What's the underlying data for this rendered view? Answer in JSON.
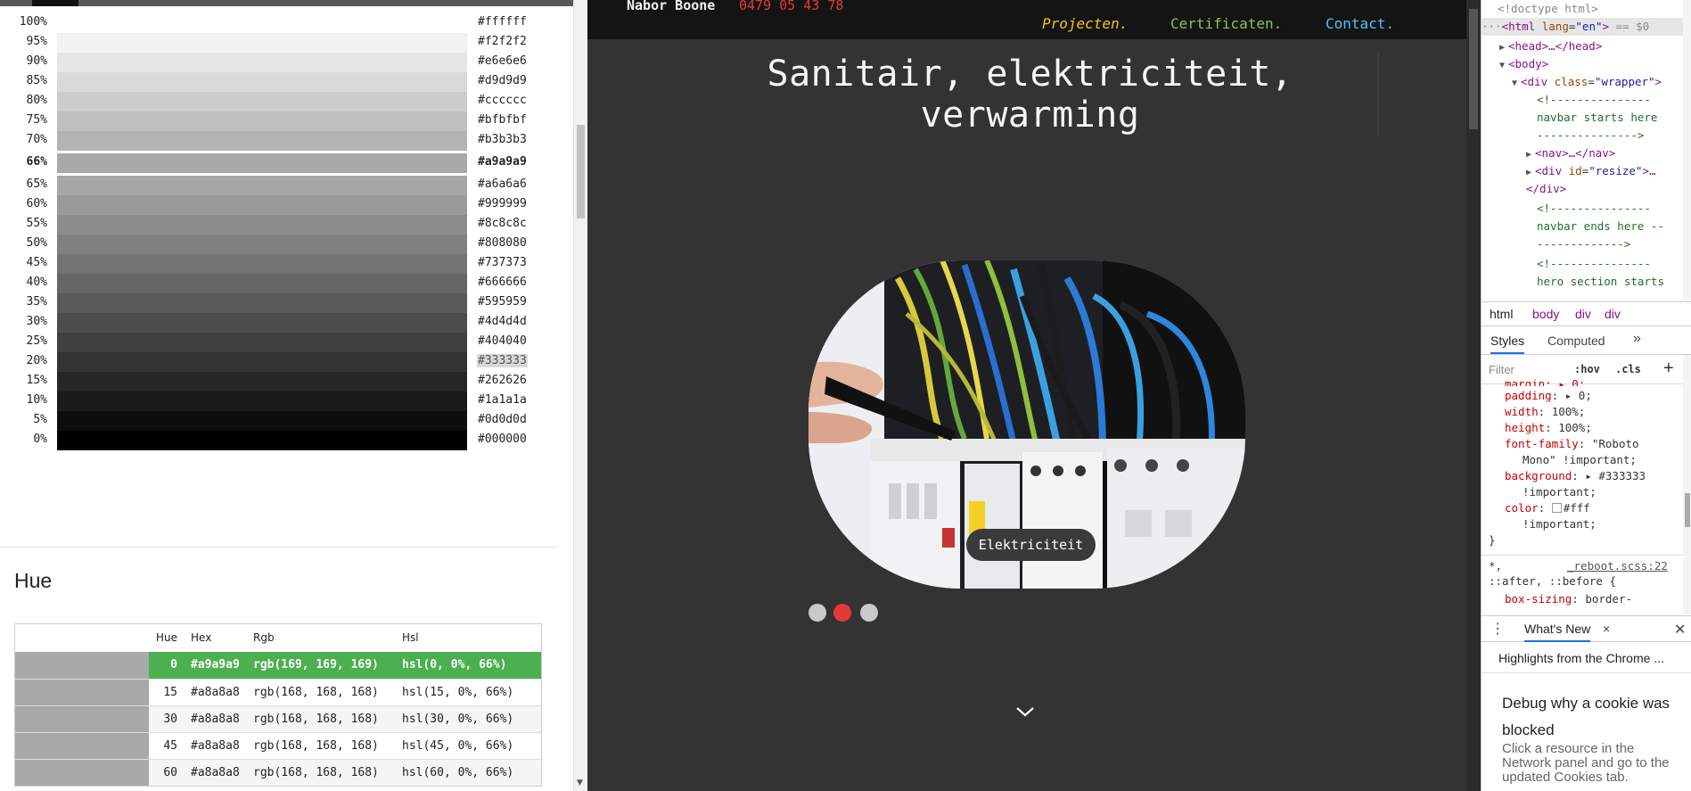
{
  "shades": [
    {
      "pct": "100%",
      "hex": "#ffffff",
      "color": "#ffffff"
    },
    {
      "pct": "95%",
      "hex": "#f2f2f2",
      "color": "#f2f2f2"
    },
    {
      "pct": "90%",
      "hex": "#e6e6e6",
      "color": "#e6e6e6"
    },
    {
      "pct": "85%",
      "hex": "#d9d9d9",
      "color": "#d9d9d9"
    },
    {
      "pct": "80%",
      "hex": "#cccccc",
      "color": "#cccccc"
    },
    {
      "pct": "75%",
      "hex": "#bfbfbf",
      "color": "#bfbfbf"
    },
    {
      "pct": "70%",
      "hex": "#b3b3b3",
      "color": "#b3b3b3"
    },
    {
      "pct": "66%",
      "hex": "#a9a9a9",
      "color": "#a9a9a9"
    },
    {
      "pct": "65%",
      "hex": "#a6a6a6",
      "color": "#a6a6a6"
    },
    {
      "pct": "60%",
      "hex": "#999999",
      "color": "#999999"
    },
    {
      "pct": "55%",
      "hex": "#8c8c8c",
      "color": "#8c8c8c"
    },
    {
      "pct": "50%",
      "hex": "#808080",
      "color": "#808080"
    },
    {
      "pct": "45%",
      "hex": "#737373",
      "color": "#737373"
    },
    {
      "pct": "40%",
      "hex": "#666666",
      "color": "#666666"
    },
    {
      "pct": "35%",
      "hex": "#595959",
      "color": "#595959"
    },
    {
      "pct": "30%",
      "hex": "#4d4d4d",
      "color": "#4d4d4d"
    },
    {
      "pct": "25%",
      "hex": "#404040",
      "color": "#404040"
    },
    {
      "pct": "20%",
      "hex": "#333333",
      "color": "#333333"
    },
    {
      "pct": "15%",
      "hex": "#262626",
      "color": "#262626"
    },
    {
      "pct": "10%",
      "hex": "#1a1a1a",
      "color": "#1a1a1a"
    },
    {
      "pct": "5%",
      "hex": "#0d0d0d",
      "color": "#0d0d0d"
    },
    {
      "pct": "0%",
      "hex": "#000000",
      "color": "#000000"
    }
  ],
  "hue": {
    "heading": "Hue",
    "headers": {
      "hue": "Hue",
      "hex": "Hex",
      "rgb": "Rgb",
      "hsl": "Hsl"
    },
    "rows": [
      {
        "hue": "0",
        "hex": "#a9a9a9",
        "rgb": "rgb(169, 169, 169)",
        "hsl": "hsl(0, 0%, 66%)",
        "swatch": "#a9a9a9"
      },
      {
        "hue": "15",
        "hex": "#a8a8a8",
        "rgb": "rgb(168, 168, 168)",
        "hsl": "hsl(15, 0%, 66%)",
        "swatch": "#a8a8a8"
      },
      {
        "hue": "30",
        "hex": "#a8a8a8",
        "rgb": "rgb(168, 168, 168)",
        "hsl": "hsl(30, 0%, 66%)",
        "swatch": "#a8a8a8"
      },
      {
        "hue": "45",
        "hex": "#a8a8a8",
        "rgb": "rgb(168, 168, 168)",
        "hsl": "hsl(45, 0%, 66%)",
        "swatch": "#a8a8a8"
      },
      {
        "hue": "60",
        "hex": "#a8a8a8",
        "rgb": "rgb(168, 168, 168)",
        "hsl": "hsl(60, 0%, 66%)",
        "swatch": "#a8a8a8"
      }
    ]
  },
  "site": {
    "brand": "Nabor Boone",
    "phone": "0479 05 43 78",
    "nav": {
      "projecten": "Projecten.",
      "certificaten": "Certificaten.",
      "contact": "Contact."
    },
    "hero_title": "Sanitair, elektriciteit, verwarming",
    "slide_label": "Elektriciteit",
    "active_dot": 2,
    "colors": {
      "phone": "#e53935",
      "projecten": "#f5c518",
      "certificaten": "#8bc34a",
      "contact": "#4fc3f7",
      "dot_active": "#e53935"
    }
  },
  "devtools": {
    "dom": {
      "doctype": "<!doctype html>",
      "html_open": "<html",
      "lang_attr": "lang",
      "lang_val": "\"en\"",
      "html_close": ">",
      "selected_marker": "== $0",
      "head": "<head>…</head>",
      "body": "<body>",
      "div_open": "<div",
      "class_attr": "class",
      "class_val": "\"wrapper\"",
      "div_gt": ">",
      "comment1a": "<!---------------",
      "comment1b": "navbar starts here",
      "comment1c": "--------------->",
      "nav": "<nav>…</nav>",
      "resize_open": "<div",
      "id_attr": "id",
      "resize_val": "\"resize\"",
      "resize_end": ">…",
      "div_close": "</div>",
      "comment2a": "<!---------------",
      "comment2b": "navbar ends here --",
      "comment2c": "------------->",
      "comment3a": "<!---------------",
      "comment3b": "hero section starts"
    },
    "breadcrumb": [
      "html",
      "body",
      "div",
      "div"
    ],
    "tabs": {
      "styles": "Styles",
      "computed": "Computed",
      "more": "»"
    },
    "filter_placeholder": "Filter",
    "hov": ":hov",
    "cls": ".cls",
    "plus": "+",
    "css": {
      "margin_cut": "margin: ▸ 0;",
      "padding_prop": "padding",
      "padding_val": "▸ 0;",
      "width_prop": "width",
      "width_val": "100%;",
      "height_prop": "height",
      "height_val": "100%;",
      "font_prop": "font-family",
      "font_val": "\"Roboto",
      "font_val2": "Mono\" !important;",
      "bg_prop": "background",
      "bg_val": "▸ #333333",
      "bg_imp": "!important;",
      "color_prop": "color",
      "color_val": "#fff",
      "color_imp": "!important;",
      "brace": "}",
      "selector": "*,",
      "source": "_reboot.scss:22",
      "selector2": "::after, ::before {",
      "box_prop": "box-sizing",
      "box_val": "border-"
    },
    "drawer": {
      "dots": "⋮",
      "title": "What's New",
      "close_tab": "×",
      "close": "✕",
      "highlights": "Highlights from the Chrome ...",
      "card_title": "Debug why a cookie was blocked",
      "card_body": "Click a resource in the Network panel and go to the updated Cookies tab."
    }
  }
}
